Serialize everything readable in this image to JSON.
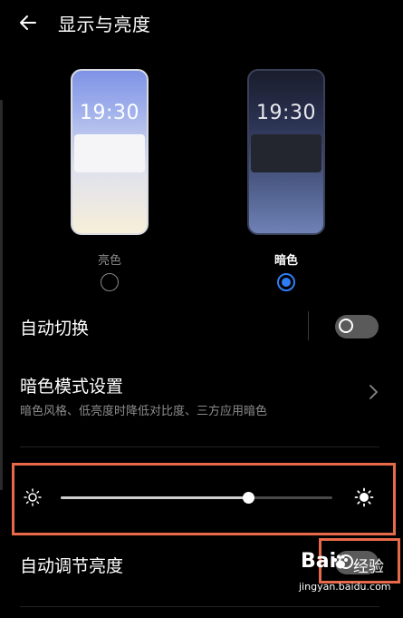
{
  "header": {
    "title": "显示与亮度",
    "back_icon": "arrow-left-icon"
  },
  "theme_preview": {
    "light": {
      "time": "19:30",
      "label": "亮色",
      "selected": false
    },
    "dark": {
      "time": "19:30",
      "label": "暗色",
      "selected": true
    }
  },
  "auto_switch": {
    "label": "自动切换",
    "enabled": false
  },
  "dark_mode_settings": {
    "label": "暗色模式设置",
    "subtitle": "暗色风格、低亮度时降低对比度、三方应用暗色"
  },
  "brightness": {
    "level": 0.69,
    "min_icon": "sun-outline-icon",
    "max_icon": "sun-filled-icon"
  },
  "auto_brightness": {
    "label": "自动调节亮度",
    "enabled": false
  },
  "watermark": {
    "brand": "Bai",
    "brand_suffix": "经验",
    "url": "jingyan.baidu.com"
  },
  "colors": {
    "accent": "#2f7df6",
    "highlight": "#e8694a",
    "background": "#000000"
  }
}
